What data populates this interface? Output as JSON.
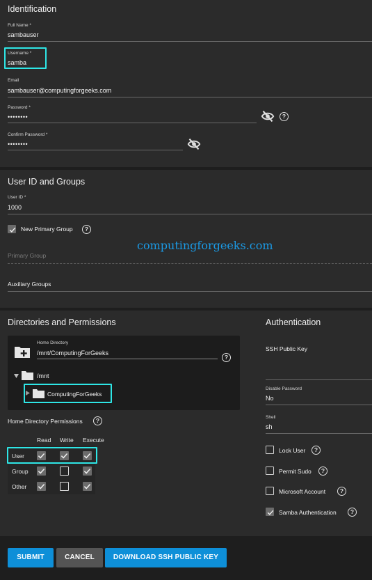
{
  "identification": {
    "title": "Identification",
    "full_name_label": "Full Name *",
    "full_name_value": "sambauser",
    "username_label": "Username *",
    "username_value": "samba",
    "email_label": "Email",
    "email_value": "sambauser@computingforgeeks.com",
    "password_label": "Password *",
    "password_value": "••••••••",
    "confirm_label": "Confirm Password *",
    "confirm_value": "••••••••"
  },
  "user_groups": {
    "title": "User ID and Groups",
    "user_id_label": "User ID *",
    "user_id_value": "1000",
    "new_primary_group_label": "New Primary Group",
    "new_primary_group_checked": true,
    "primary_group_placeholder": "Primary Group",
    "auxiliary_groups_label": "Auxiliary Groups"
  },
  "watermark": "computingforgeeks.com",
  "directories": {
    "title": "Directories and Permissions",
    "home_dir_label": "Home Directory",
    "home_dir_value": "/mnt/ComputingForGeeks",
    "tree_root": "/mnt",
    "tree_child": "ComputingForGeeks",
    "permissions_label": "Home Directory Permissions",
    "columns": [
      "Read",
      "Write",
      "Execute"
    ],
    "rows": [
      {
        "name": "User",
        "read": true,
        "write": true,
        "execute": true
      },
      {
        "name": "Group",
        "read": true,
        "write": false,
        "execute": true
      },
      {
        "name": "Other",
        "read": true,
        "write": false,
        "execute": true
      }
    ]
  },
  "authentication": {
    "title": "Authentication",
    "ssh_key_label": "SSH Public Key",
    "disable_password_label": "Disable Password",
    "disable_password_value": "No",
    "shell_label": "Shell",
    "shell_value": "sh",
    "lock_user_label": "Lock User",
    "lock_user_checked": false,
    "permit_sudo_label": "Permit Sudo",
    "permit_sudo_checked": false,
    "microsoft_account_label": "Microsoft Account",
    "microsoft_account_checked": false,
    "samba_auth_label": "Samba Authentication",
    "samba_auth_checked": true
  },
  "buttons": {
    "submit": "SUBMIT",
    "cancel": "CANCEL",
    "download": "DOWNLOAD SSH PUBLIC KEY"
  },
  "colors": {
    "accent": "#0e8fd8",
    "highlight": "#2ee6e6",
    "watermark": "#1b9ae5"
  }
}
